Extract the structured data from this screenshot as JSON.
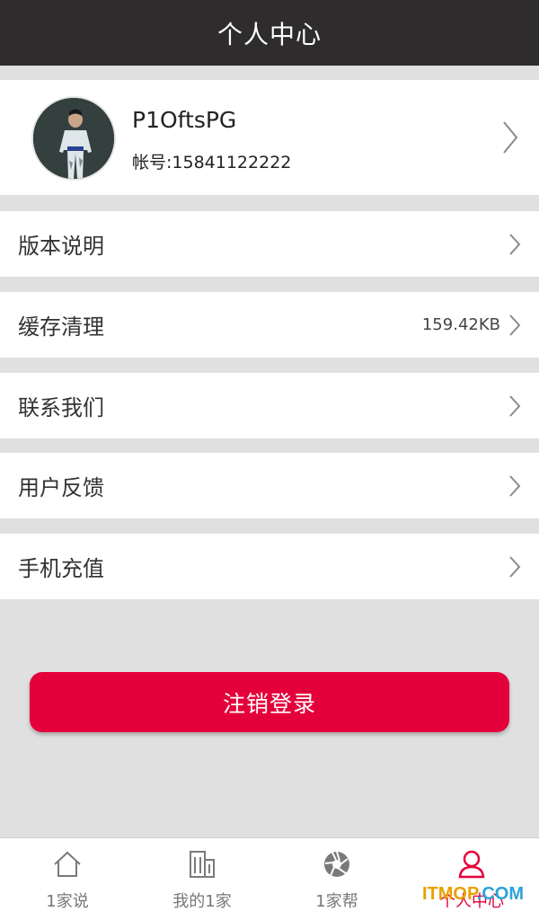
{
  "header": {
    "title": "个人中心"
  },
  "profile": {
    "username": "P1OftsPG",
    "account_label": "帐号:",
    "account_value": "15841122222"
  },
  "menu": [
    {
      "label": "版本说明",
      "value": ""
    },
    {
      "label": "缓存清理",
      "value": "159.42KB"
    },
    {
      "label": "联系我们",
      "value": ""
    },
    {
      "label": "用户反馈",
      "value": ""
    },
    {
      "label": "手机充值",
      "value": ""
    }
  ],
  "logout_label": "注销登录",
  "tabs": [
    {
      "label": "1家说",
      "icon": "home-icon",
      "active": false
    },
    {
      "label": "我的1家",
      "icon": "building-icon",
      "active": false
    },
    {
      "label": "1家帮",
      "icon": "aperture-icon",
      "active": false
    },
    {
      "label": "个人中心",
      "icon": "user-icon",
      "active": true
    }
  ],
  "watermark": {
    "part1": "ITMOP",
    "part2": ".COM"
  },
  "colors": {
    "titlebar_bg": "#2e2c2d",
    "accent": "#e4003a",
    "page_bg": "#e0e0e0"
  }
}
